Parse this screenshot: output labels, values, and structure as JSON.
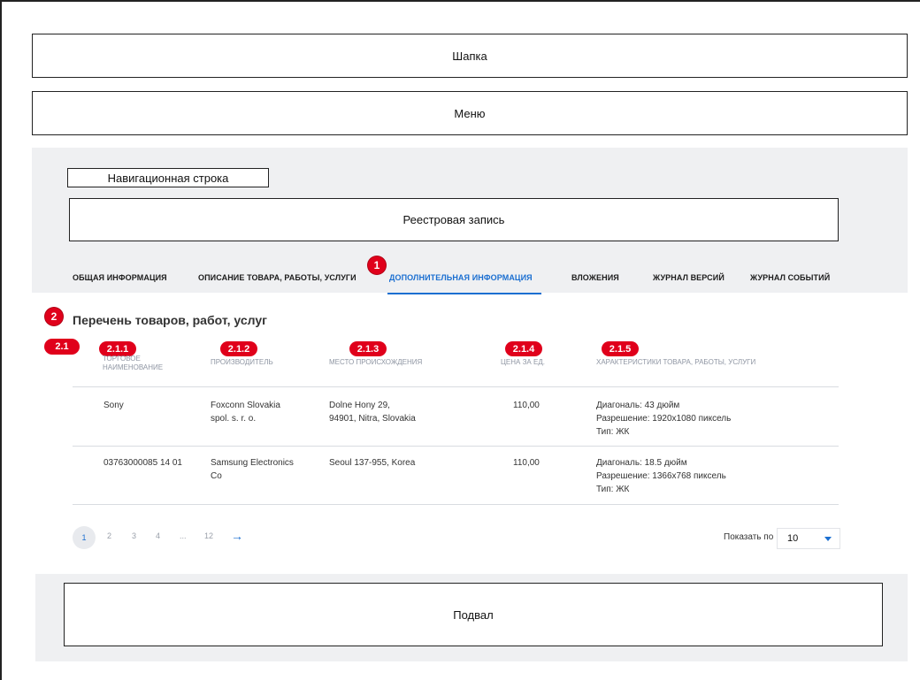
{
  "layout_blocks": {
    "header": "Шапка",
    "menu": "Меню",
    "breadcrumb": "Навигационная строка",
    "registry_record": "Реестровая запись",
    "footer": "Подвал"
  },
  "tabs": [
    {
      "label": "ОБЩАЯ ИНФОРМАЦИЯ",
      "active": false
    },
    {
      "label": "ОПИСАНИЕ ТОВАРА, РАБОТЫ, УСЛУГИ",
      "active": false
    },
    {
      "label": "ДОПОЛНИТЕЛЬНАЯ ИНФОРМАЦИЯ",
      "active": true
    },
    {
      "label": "ВЛОЖЕНИЯ",
      "active": false
    },
    {
      "label": "ЖУРНАЛ ВЕРСИЙ",
      "active": false
    },
    {
      "label": "ЖУРНАЛ СОБЫТИЙ",
      "active": false
    }
  ],
  "markers": {
    "m1": "1",
    "m2": "2",
    "m21": "2.1",
    "m211": "2.1.1",
    "m212": "2.1.2",
    "m213": "2.1.3",
    "m214": "2.1.4",
    "m215": "2.1.5"
  },
  "section": {
    "title": "Перечень товаров, работ, услуг"
  },
  "table": {
    "columns": {
      "trade_name_1": "ТОРГОВОЕ",
      "trade_name_2": "НАИМЕНОВАНИЕ",
      "manufacturer": "ПРОИЗВОДИТЕЛЬ",
      "origin": "МЕСТО ПРОИСХОЖДЕНИЯ",
      "price": "ЦЕНА ЗА ЕД.",
      "characteristics": "ХАРАКТЕРИСТИКИ ТОВАРА, РАБОТЫ, УСЛУГИ"
    },
    "rows": [
      {
        "trade_name": "Sony",
        "manufacturer_1": "Foxconn Slovakia",
        "manufacturer_2": "spol. s. r. o.",
        "origin_1": "Dolne Hony 29,",
        "origin_2": "94901, Nitra, Slovakia",
        "price": "110,00",
        "char_1": "Диагональ: 43 дюйм",
        "char_2": "Разрешение: 1920х1080 пиксель",
        "char_3": "Тип: ЖК"
      },
      {
        "trade_name": "03763000085 14 01",
        "manufacturer_1": "Samsung Electronics",
        "manufacturer_2": "Co",
        "origin_1": "Seoul 137-955, Korea",
        "origin_2": "",
        "price": "110,00",
        "char_1": "Диагональ: 18.5 дюйм",
        "char_2": "Разрешение: 1366х768 пиксель",
        "char_3": "Тип: ЖК"
      }
    ]
  },
  "pagination": {
    "current": "1",
    "pages": [
      "2",
      "3",
      "4",
      "...",
      "12"
    ],
    "next_icon": "arrow-right-icon",
    "show_label": "Показать по",
    "page_size": "10"
  },
  "colors": {
    "accent": "#1b6fd1",
    "marker": "#e0001b",
    "panel": "#eff0f2"
  }
}
